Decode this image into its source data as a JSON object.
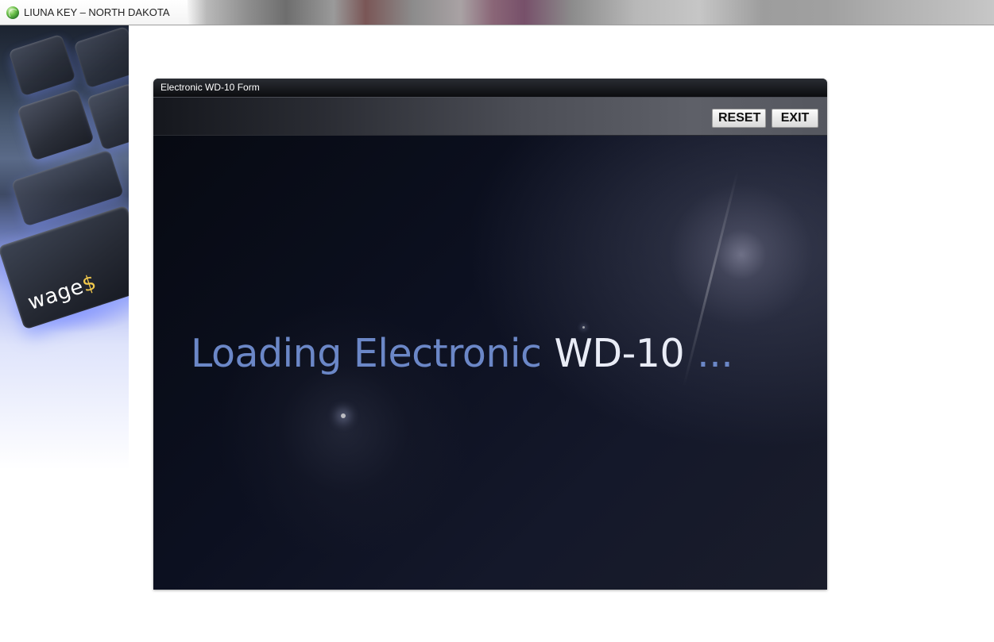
{
  "window": {
    "title": "LIUNA KEY – NORTH DAKOTA",
    "icon": "globe-refresh-icon"
  },
  "sidebar": {
    "brand_text": "wage",
    "brand_symbol": "$"
  },
  "form": {
    "title": "Electronic WD-10 Form",
    "toolbar": {
      "reset_label": "RESET",
      "exit_label": "EXIT"
    },
    "loading": {
      "prefix": "Loading Electronic",
      "highlight": "WD-10",
      "suffix": "..."
    }
  },
  "colors": {
    "loading_accent": "#6b87c7",
    "loading_highlight": "#e9ecf6",
    "stage_background": "#0a0d14"
  }
}
